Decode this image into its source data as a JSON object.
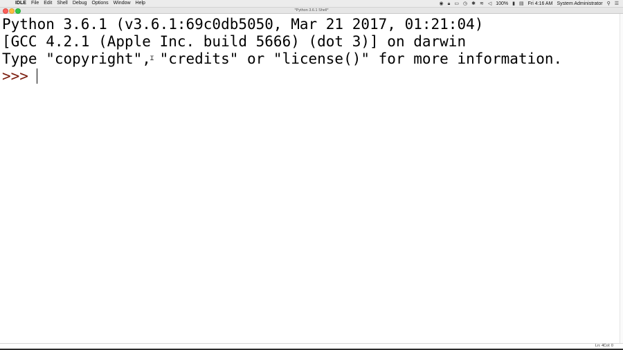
{
  "menubar": {
    "app_name": "IDLE",
    "items": [
      "File",
      "Edit",
      "Shell",
      "Debug",
      "Options",
      "Window",
      "Help"
    ],
    "status": {
      "battery": "100%",
      "datetime": "Fri 4:16 AM",
      "user": "System Administrator"
    }
  },
  "window": {
    "title": "*Python 3.6.1 Shell*"
  },
  "shell": {
    "lines": [
      "Python 3.6.1 (v3.6.1:69c0db5050, Mar 21 2017, 01:21:04)",
      "[GCC 4.2.1 (Apple Inc. build 5666) (dot 3)] on darwin",
      "Type \"copyright\", \"credits\" or \"license()\" for more information."
    ],
    "prompt": ">>>",
    "prompt_color": "#7a1b0c"
  },
  "statusbar": {
    "ln": "Ln: 4",
    "col": "Col: 0"
  }
}
